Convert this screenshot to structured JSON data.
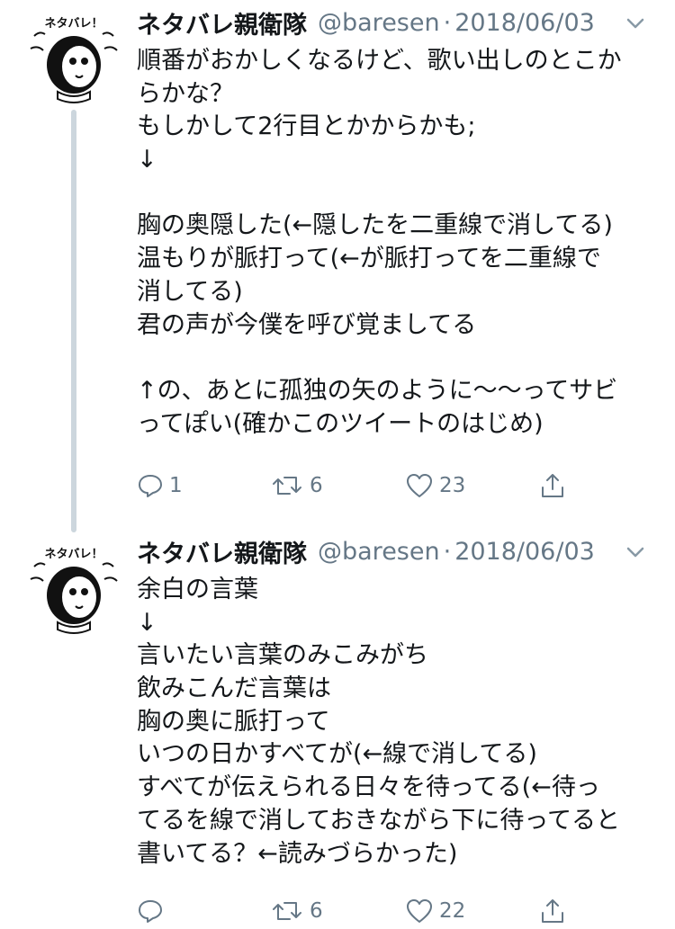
{
  "tweets": [
    {
      "display_name": "ネタバレ親衛隊",
      "handle": "@baresen",
      "separator": "·",
      "date": "2018/06/03",
      "avatar_caption": "ネタバレ！",
      "lines": [
        "順番がおかしくなるけど、歌い出しのとこか",
        "らかな？",
        "もしかして2行目とかからかも;",
        "↓",
        "",
        "胸の奥隠した(←隠したを二重線で消してる)",
        "温もりが脈打って(←が脈打ってを二重線で",
        "消してる)",
        "君の声が今僕を呼び覚ましてる",
        "",
        "↑の、あとに孤独の矢のように〜〜ってサビ",
        "ってぽい(確かこのツイートのはじめ)"
      ],
      "counts": {
        "reply": "1",
        "retweet": "6",
        "like": "23"
      }
    },
    {
      "display_name": "ネタバレ親衛隊",
      "handle": "@baresen",
      "separator": "·",
      "date": "2018/06/03",
      "avatar_caption": "ネタバレ！",
      "lines": [
        "余白の言葉",
        "↓",
        "言いたい言葉のみこみがち",
        "飲みこんだ言葉は",
        "胸の奥に脈打って",
        "いつの日かすべてが(←線で消してる)",
        "すべてが伝えられる日々を待ってる(←待っ",
        "てるを線で消しておきながら下に待ってると",
        "書いてる？←読みづらかった)"
      ],
      "counts": {
        "reply": "",
        "retweet": "6",
        "like": "22"
      }
    }
  ],
  "colors": {
    "text": "#14171a",
    "secondary": "#657786",
    "thread_line": "#ccd6dd"
  },
  "icons": [
    "reply-icon",
    "retweet-icon",
    "like-icon",
    "share-icon",
    "chevron-down-icon"
  ]
}
